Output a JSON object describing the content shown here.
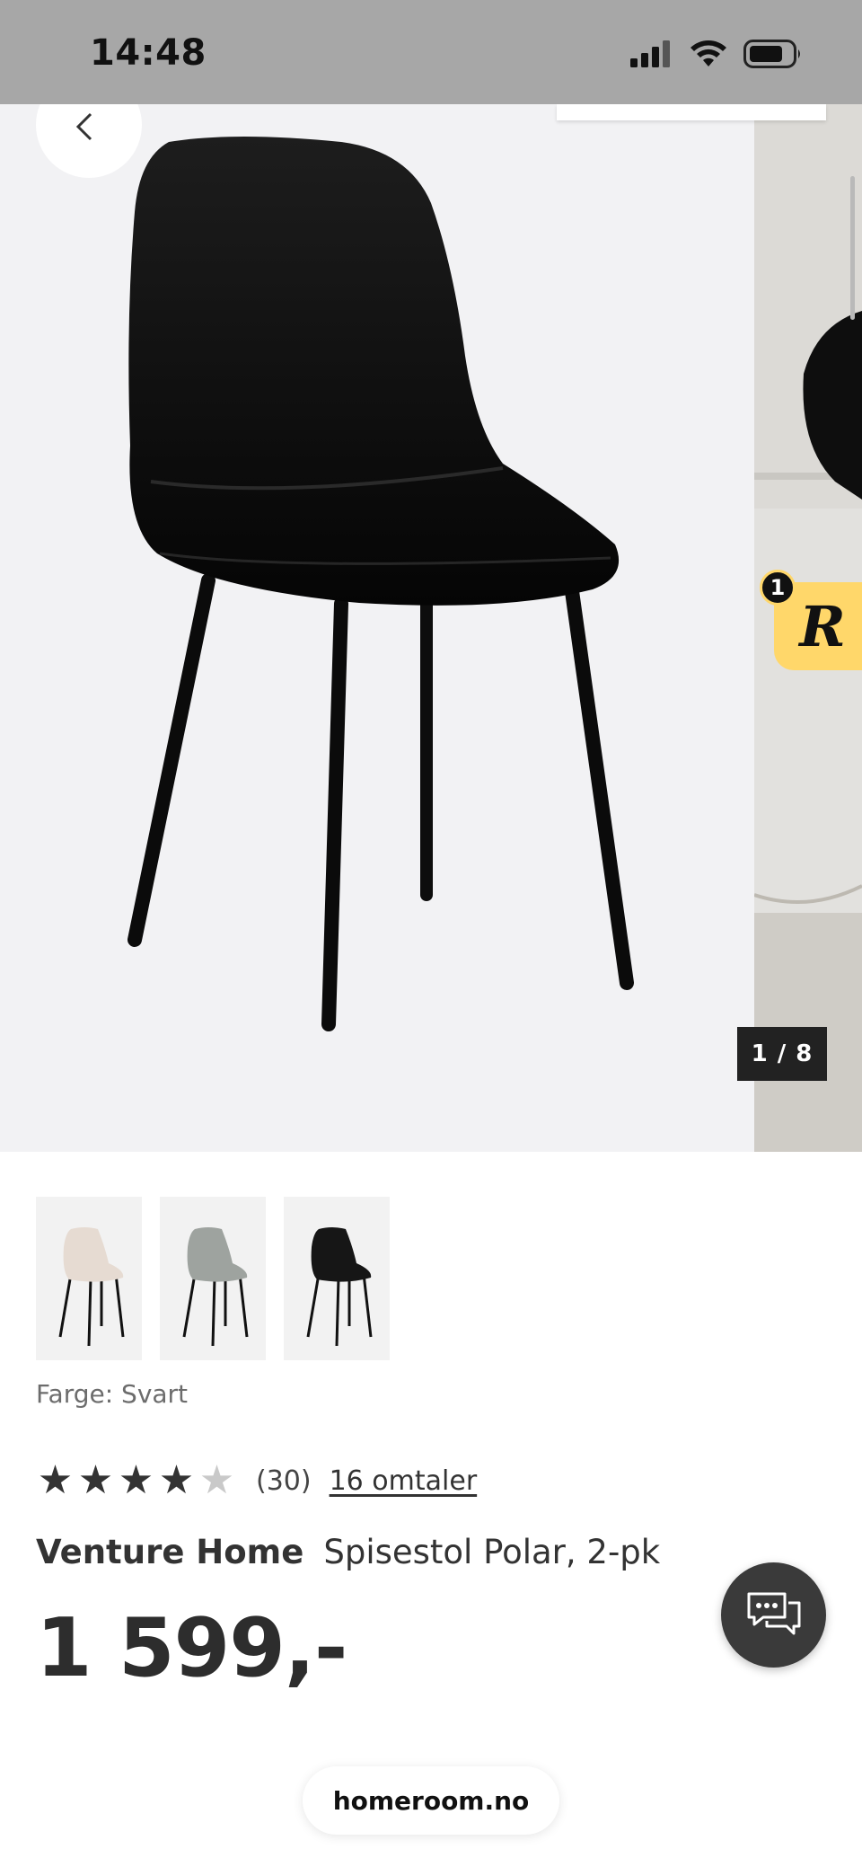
{
  "status_bar": {
    "time": "14:48",
    "icons": [
      "cellular-signal-icon",
      "wifi-icon",
      "battery-icon"
    ]
  },
  "gallery": {
    "counter": "1 / 8",
    "back_icon": "back-arrow-icon",
    "reward_badge_count": "1",
    "reward_letter": "R",
    "reward_color": "#ffd76a"
  },
  "variants": [
    {
      "name": "beige",
      "color": "#e6dbd2"
    },
    {
      "name": "grey",
      "color": "#9ea39f"
    },
    {
      "name": "black",
      "color": "#161616"
    }
  ],
  "product": {
    "color_label": "Farge: Svart",
    "rating": 4,
    "rating_max": 5,
    "rating_count": "(30)",
    "reviews_link": "16 omtaler",
    "brand": "Venture Home",
    "name": "Spisestol Polar, 2-pk",
    "price": "1 599,-"
  },
  "chat_icon": "chat-bubble-icon",
  "browser": {
    "url": "homeroom.no"
  }
}
